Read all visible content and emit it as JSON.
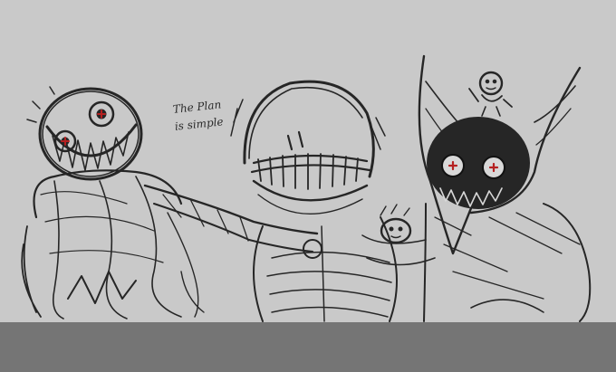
{
  "caption": {
    "line1": "The Plan",
    "line2": "is simple"
  },
  "colors": {
    "background": "#c9c9c9",
    "ink": "#262626",
    "eye_accent": "#b52020",
    "bottom_band": "#757575"
  },
  "figures": [
    "grinning-round-head-creature",
    "skull-face-creature",
    "horned-dark-creature",
    "small-figure-on-head",
    "small-figure-held"
  ]
}
